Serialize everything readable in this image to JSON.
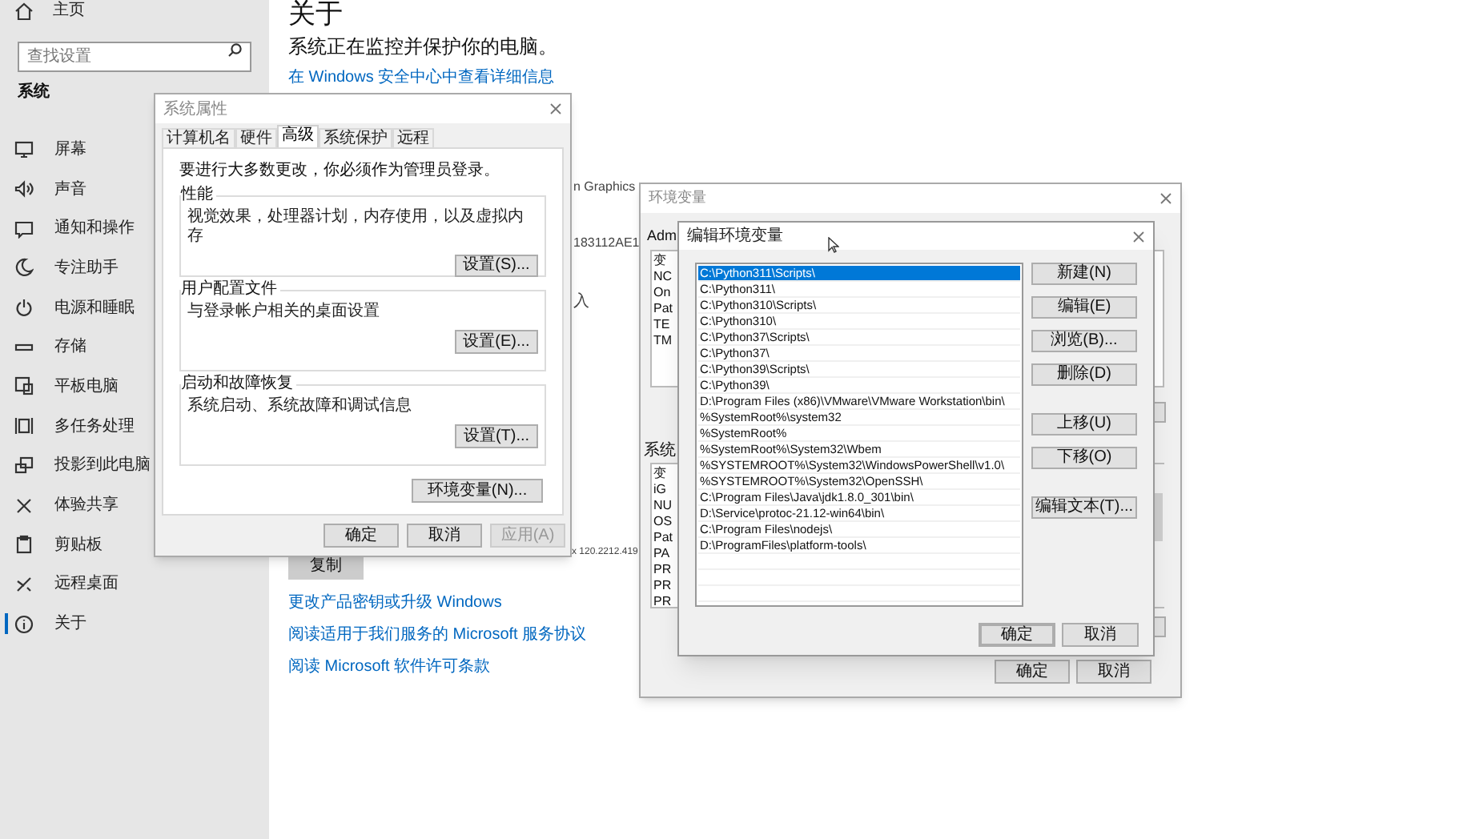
{
  "sidebar": {
    "home": "主页",
    "search_placeholder": "查找设置",
    "section": "系统",
    "items": [
      {
        "label": "屏幕",
        "selected": false
      },
      {
        "label": "声音",
        "selected": false
      },
      {
        "label": "通知和操作",
        "selected": false
      },
      {
        "label": "专注助手",
        "selected": false
      },
      {
        "label": "电源和睡眠",
        "selected": false
      },
      {
        "label": "存储",
        "selected": false
      },
      {
        "label": "平板电脑",
        "selected": false
      },
      {
        "label": "多任务处理",
        "selected": false
      },
      {
        "label": "投影到此电脑",
        "selected": false
      },
      {
        "label": "体验共享",
        "selected": false
      },
      {
        "label": "剪贴板",
        "selected": false
      },
      {
        "label": "远程桌面",
        "selected": false
      },
      {
        "label": "关于",
        "selected": true
      }
    ]
  },
  "about": {
    "title": "关于",
    "status": "系统正在监控并保护你的电脑。",
    "security_link": "在 Windows 安全中心中查看详细信息",
    "peek_texts": [
      "n Graphics",
      "183112AE1",
      "入",
      "x 120.2212.419"
    ],
    "copy_button": "复制",
    "links": [
      "更改产品密钥或升级 Windows",
      "阅读适用于我们服务的 Microsoft 服务协议",
      "阅读 Microsoft 软件许可条款"
    ]
  },
  "system_properties": {
    "title": "系统属性",
    "tabs": [
      {
        "label": "计算机名",
        "selected": false
      },
      {
        "label": "硬件",
        "selected": false
      },
      {
        "label": "高级",
        "selected": true
      },
      {
        "label": "系统保护",
        "selected": false
      },
      {
        "label": "远程",
        "selected": false
      }
    ],
    "notice": "要进行大多数更改，你必须作为管理员登录。",
    "groups": [
      {
        "title": "性能",
        "text": "视觉效果，处理器计划，内存使用，以及虚拟内存",
        "button": "设置(S)..."
      },
      {
        "title": "用户配置文件",
        "text": "与登录帐户相关的桌面设置",
        "button": "设置(E)..."
      },
      {
        "title": "启动和故障恢复",
        "text": "系统启动、系统故障和调试信息",
        "button": "设置(T)..."
      }
    ],
    "env_button": "环境变量(N)...",
    "buttons": [
      {
        "label": "确定",
        "disabled": false
      },
      {
        "label": "取消",
        "disabled": false
      },
      {
        "label": "应用(A)",
        "disabled": true
      }
    ]
  },
  "environment_variables": {
    "title": "环境变量",
    "user_label": "Adm",
    "user_rows": [
      "变",
      "NC",
      "On",
      "Pat",
      "TE",
      "TM"
    ],
    "system_label": "系统",
    "system_rows": [
      "变",
      "iG",
      "NU",
      "OS",
      "Pat",
      "PA",
      "PR",
      "PR",
      "PR"
    ],
    "buttons": [
      "确定",
      "取消"
    ]
  },
  "edit_variable": {
    "title": "编辑环境变量",
    "paths": [
      {
        "text": "C:\\Python311\\Scripts\\",
        "selected": true
      },
      {
        "text": "C:\\Python311\\",
        "selected": false
      },
      {
        "text": "C:\\Python310\\Scripts\\",
        "selected": false
      },
      {
        "text": "C:\\Python310\\",
        "selected": false
      },
      {
        "text": "C:\\Python37\\Scripts\\",
        "selected": false
      },
      {
        "text": "C:\\Python37\\",
        "selected": false
      },
      {
        "text": "C:\\Python39\\Scripts\\",
        "selected": false
      },
      {
        "text": "C:\\Python39\\",
        "selected": false
      },
      {
        "text": "D:\\Program Files (x86)\\VMware\\VMware Workstation\\bin\\",
        "selected": false
      },
      {
        "text": "%SystemRoot%\\system32",
        "selected": false
      },
      {
        "text": "%SystemRoot%",
        "selected": false
      },
      {
        "text": "%SystemRoot%\\System32\\Wbem",
        "selected": false
      },
      {
        "text": "%SYSTEMROOT%\\System32\\WindowsPowerShell\\v1.0\\",
        "selected": false
      },
      {
        "text": "%SYSTEMROOT%\\System32\\OpenSSH\\",
        "selected": false
      },
      {
        "text": "C:\\Program Files\\Java\\jdk1.8.0_301\\bin\\",
        "selected": false
      },
      {
        "text": "D:\\Service\\protoc-21.12-win64\\bin\\",
        "selected": false
      },
      {
        "text": "C:\\Program Files\\nodejs\\",
        "selected": false
      },
      {
        "text": "D:\\ProgramFiles\\platform-tools\\",
        "selected": false
      }
    ],
    "side_buttons": [
      "新建(N)",
      "编辑(E)",
      "浏览(B)...",
      "删除(D)",
      "上移(U)",
      "下移(O)",
      "编辑文本(T)..."
    ],
    "buttons": [
      {
        "label": "确定",
        "default": true
      },
      {
        "label": "取消",
        "default": false
      }
    ]
  }
}
